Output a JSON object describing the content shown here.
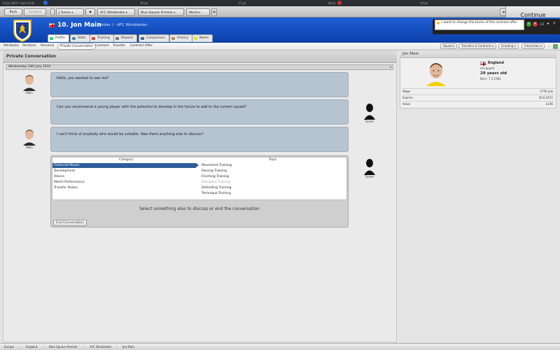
{
  "timeline": {
    "date_label": "14 Jul 2010",
    "next_label": "main finds",
    "markers": [
      "16 Jul",
      "17 Jul",
      "18 Jul",
      "19 Jul"
    ]
  },
  "topnav": {
    "back": "Back",
    "forward": "Forward",
    "manager_dropdown": "J Turner",
    "club_dropdown": "AFC Wimbledon",
    "league_dropdown": "Blue Square Premier",
    "region_dropdown": "World",
    "fm_label": "FM",
    "continue": "Continue"
  },
  "header": {
    "player_title": "10. Jon Main",
    "player_role": "Striker / - AFC Wimbledon",
    "tabs": [
      "Profile",
      "Stats",
      "Training",
      "Reports",
      "Comparison",
      "History",
      "Notes"
    ],
    "notification": "I want to change the terms of the contract offer",
    "notification_count": "1/2"
  },
  "subnav": {
    "items": [
      "Attributes",
      "Positions",
      "Personal",
      "Private Conversation",
      "Contract",
      "Transfer",
      "Contract Offer"
    ],
    "buttons": [
      "Squad",
      "Transfers & Contracts",
      "Scouting",
      "Interaction"
    ]
  },
  "conversation": {
    "title": "Private Conversation",
    "date": "Wednesday 14th July 2010",
    "messages": [
      {
        "speaker": "Main",
        "text": "Hello, you wanted to see me?"
      },
      {
        "speaker": "Turner",
        "text": "Can you recommend a young player with the potential to develop in the future to add to the current squad?"
      },
      {
        "speaker": "Main",
        "text": "I can't think of anybody who would be suitable. Was there anything else to discuss?"
      }
    ],
    "choice": {
      "speaker": "Turner",
      "category_header": "Category",
      "topic_header": "Topic",
      "categories": [
        "Preferred Moves",
        "Development",
        "Advice",
        "Match Performance",
        "Transfer Status"
      ],
      "topics": [
        "Movement Training",
        "Passing Training",
        "Finishing Training",
        "Discipline Training",
        "Defending Training",
        "Technique Training"
      ],
      "prompt": "Select something else to discuss or end the conversation",
      "end_button": "End Conversation"
    }
  },
  "side": {
    "title": "Jon Main",
    "nation": "England",
    "caps": "Uncapped",
    "age": "29 years old",
    "born": "Born: 7.3.1981",
    "rows": [
      {
        "label": "Wage",
        "value": "£750 p/w"
      },
      {
        "label": "Expires",
        "value": "30.6.2011"
      },
      {
        "label": "Value",
        "value": "£14K"
      }
    ]
  },
  "footer": {
    "crumbs": [
      "Europe",
      "England",
      "Blue Square Premier",
      "AFC Wimbledon",
      "Jon Main"
    ]
  },
  "colors": {
    "header_blue": "#0b3fa8",
    "bubble": "#b6c3d1",
    "selected": "#2e5e9a"
  }
}
